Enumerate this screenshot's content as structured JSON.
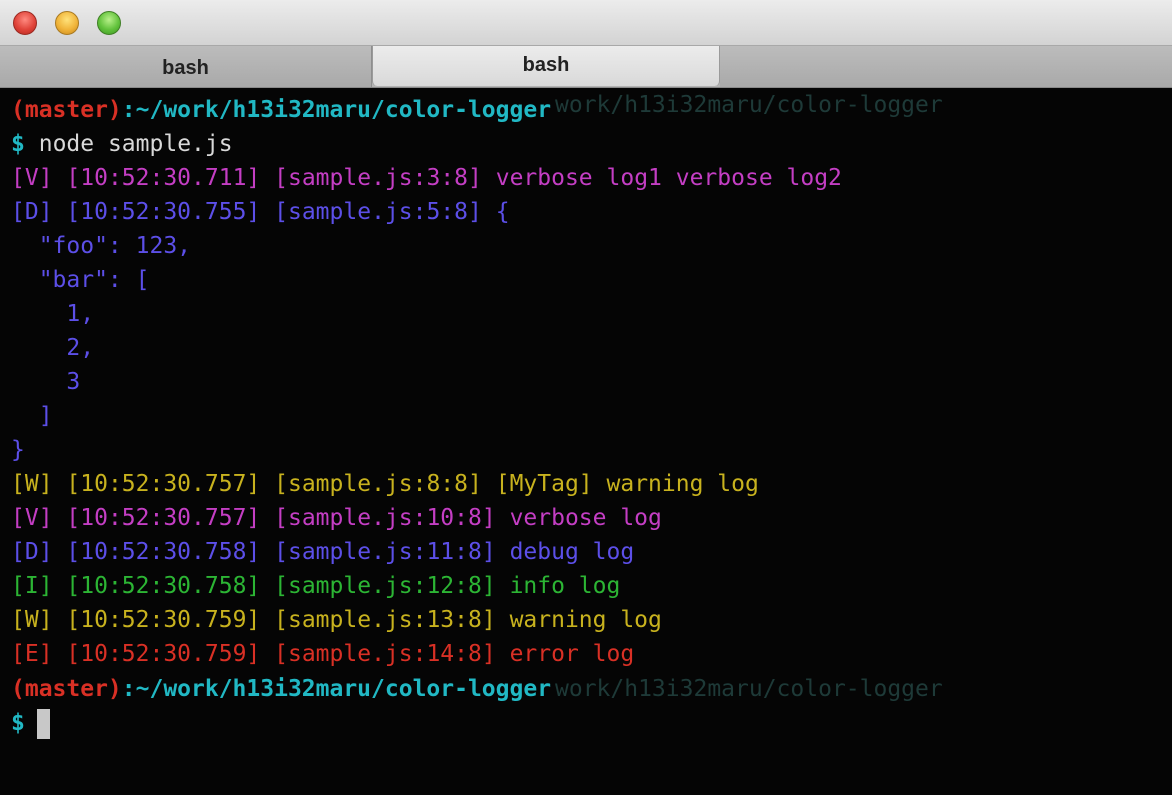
{
  "tabs": [
    {
      "label": "bash",
      "active": false
    },
    {
      "label": "bash",
      "active": true
    }
  ],
  "prompt": {
    "branch": "(master)",
    "path": ":~/work/h13i32maru/color-logger",
    "ghost": "work/h13i32maru/color-logger",
    "symbol": "$"
  },
  "command": "node sample.js",
  "lines": [
    {
      "level": "[V]",
      "time": "[10:52:30.711]",
      "loc": "[sample.js:3:8]",
      "msg": "verbose log1 verbose log2"
    },
    {
      "level": "[D]",
      "time": "[10:52:30.755]",
      "loc": "[sample.js:5:8]",
      "msg": "{"
    },
    {
      "text": "  \"foo\": 123,"
    },
    {
      "text": "  \"bar\": ["
    },
    {
      "text": "    1,"
    },
    {
      "text": "    2,"
    },
    {
      "text": "    3"
    },
    {
      "text": "  ]"
    },
    {
      "text": "}"
    },
    {
      "level": "[W]",
      "time": "[10:52:30.757]",
      "loc": "[sample.js:8:8]",
      "msg": "[MyTag] warning log"
    },
    {
      "level": "[V]",
      "time": "[10:52:30.757]",
      "loc": "[sample.js:10:8]",
      "msg": "verbose log"
    },
    {
      "level": "[D]",
      "time": "[10:52:30.758]",
      "loc": "[sample.js:11:8]",
      "msg": "debug log"
    },
    {
      "level": "[I]",
      "time": "[10:52:30.758]",
      "loc": "[sample.js:12:8]",
      "msg": "info log"
    },
    {
      "level": "[W]",
      "time": "[10:52:30.759]",
      "loc": "[sample.js:13:8]",
      "msg": "warning log"
    },
    {
      "level": "[E]",
      "time": "[10:52:30.759]",
      "loc": "[sample.js:14:8]",
      "msg": "error log"
    }
  ],
  "colors": {
    "verbose": "#c43ec4",
    "debug": "#5c4fe8",
    "info": "#2cb534",
    "warning": "#c8b21e",
    "error": "#d93025",
    "prompt_branch": "#d93025",
    "prompt_path": "#21b8c4"
  }
}
